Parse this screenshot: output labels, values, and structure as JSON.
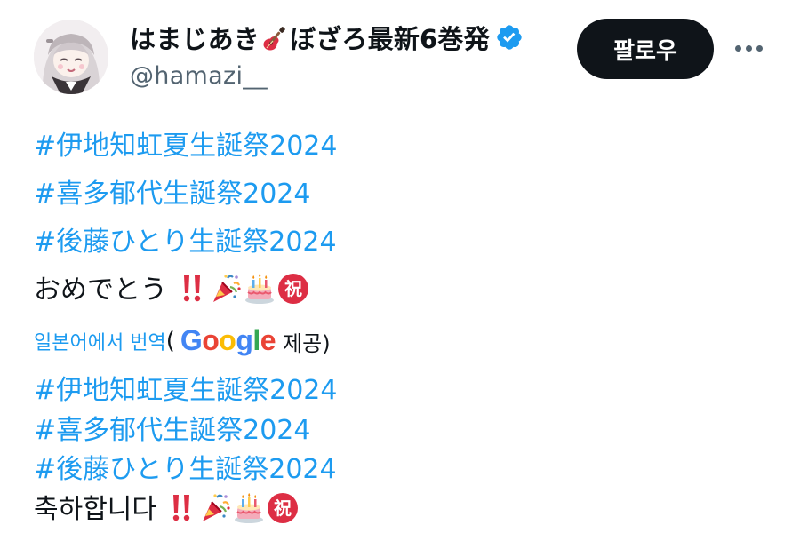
{
  "header": {
    "display_name_part1": "はまじあき",
    "display_name_part2": "ぼざろ最新6巻発",
    "handle": "@hamazi__",
    "follow_label": "팔로우"
  },
  "tweet": {
    "original": {
      "hashtags": [
        "#伊地知虹夏生誕祭2024",
        "#喜多郁代生誕祭2024",
        "#後藤ひとり生誕祭2024"
      ],
      "message": "おめでとう"
    },
    "translation": {
      "link_label": "일본어에서 번역",
      "open_paren": "(",
      "google_logo": "Google",
      "provided_by": "제공)",
      "hashtags": [
        "#伊地知虹夏生誕祭2024",
        "#喜多郁代生誕祭2024",
        "#後藤ひとり生誕祭2024"
      ],
      "message": "축하합니다"
    },
    "emojis": [
      "double-exclamation-icon",
      "party-popper-icon",
      "birthday-cake-icon",
      "congratulation-kanji-icon"
    ]
  },
  "icons": {
    "avatar": "avatar-image",
    "guitar": "guitar-icon",
    "verified": "verified-badge-icon",
    "more": "more-options-icon"
  },
  "colors": {
    "link": "#1d9bf0",
    "text": "#0f1419",
    "secondary": "#536471",
    "follow_bg": "#0f1419"
  }
}
